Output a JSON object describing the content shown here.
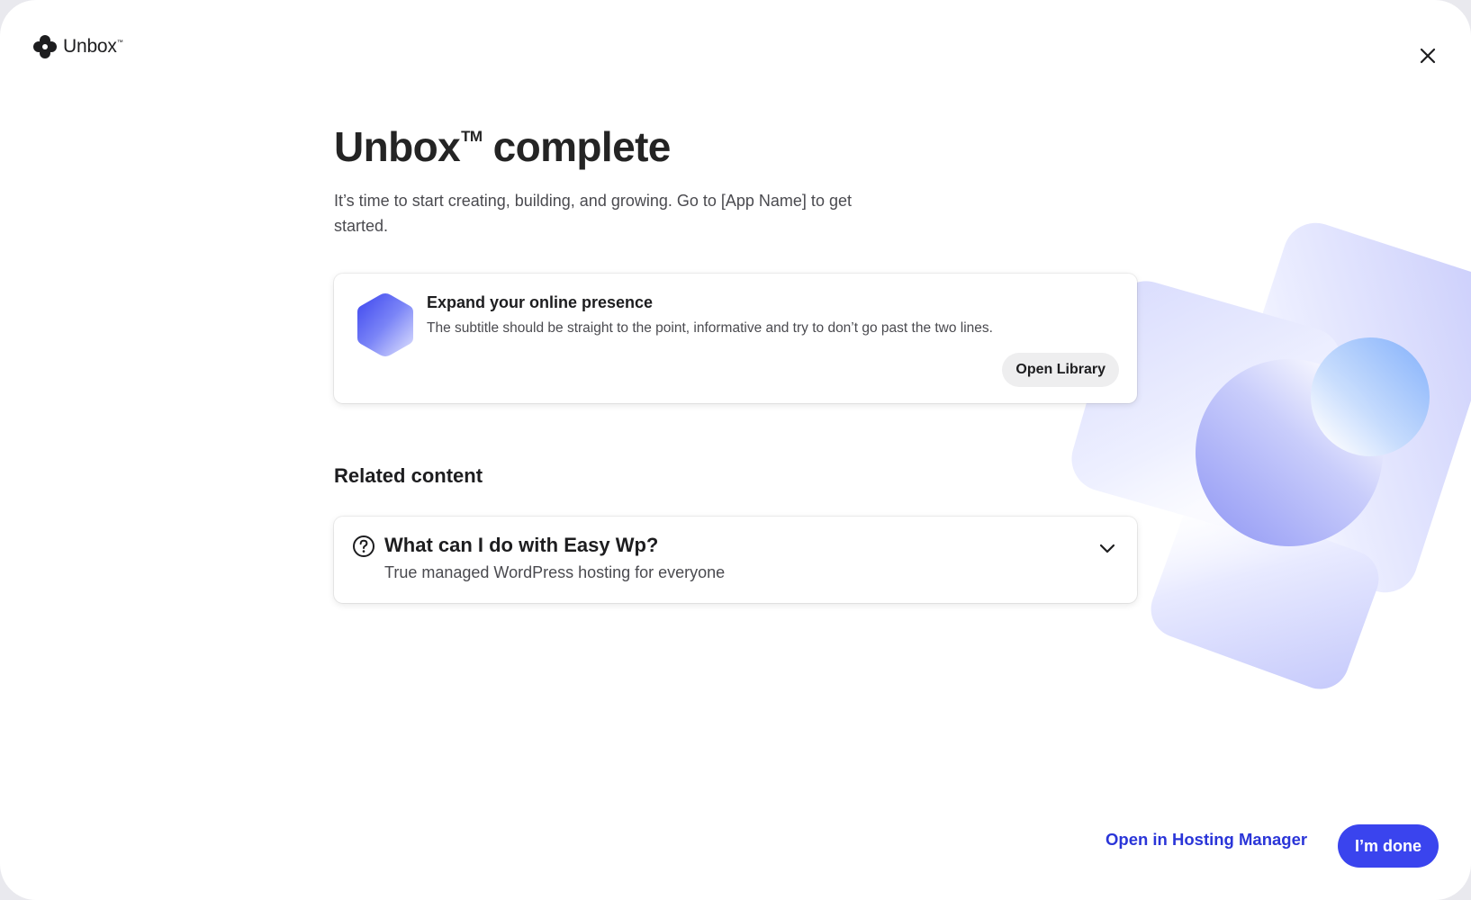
{
  "header": {
    "logo_text": "Unbox",
    "logo_tm": "™",
    "close_icon": "close-icon"
  },
  "main": {
    "title": "Unbox",
    "title_tm": "TM",
    "title_rest": " complete",
    "subtitle": "It’s time to start creating, building, and growing. Go to [App Name] to get started."
  },
  "card": {
    "icon": "hexagon-icon",
    "title": "Expand your online presence",
    "subtitle": "The subtitle should be straight to the point, informative and try to don’t go past the two lines.",
    "button_label": "Open Library"
  },
  "related": {
    "heading": "Related content",
    "items": [
      {
        "icon": "question-circle-icon",
        "question": "What can I do with Easy Wp?",
        "answer": "True managed WordPress hosting for everyone",
        "expand_icon": "chevron-down-icon"
      }
    ]
  },
  "footer": {
    "secondary_label": "Open in Hosting Manager",
    "primary_label": "I’m done"
  },
  "colors": {
    "accent": "#3a44ee",
    "link": "#2a35d8",
    "decor_lavender": "#a9aef8",
    "decor_blue": "#8fb8fb"
  }
}
